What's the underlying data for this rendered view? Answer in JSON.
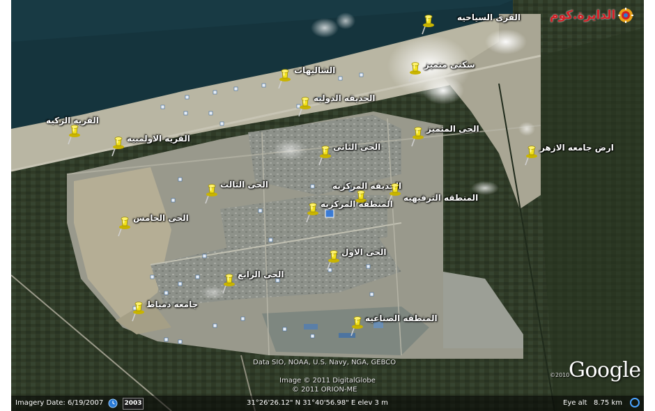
{
  "site_logo": {
    "text": "الدايرة.كوم"
  },
  "placemarks": [
    {
      "id": "tourist-villages",
      "label": "القرى السياحيه"
    },
    {
      "id": "chalets",
      "label": "الشاليهات"
    },
    {
      "id": "distinguished-housing",
      "label": "سكنى متميز"
    },
    {
      "id": "international-park",
      "label": "الحديقه الدوليه"
    },
    {
      "id": "zaki-village",
      "label": "القريه الزكيه"
    },
    {
      "id": "olympic-village",
      "label": "القريه الاولمبيه"
    },
    {
      "id": "distinguished-district",
      "label": "الحى المتميز"
    },
    {
      "id": "second-district",
      "label": "الحى الثانى"
    },
    {
      "id": "azhar-university-land",
      "label": "ارض جامعه الازهر"
    },
    {
      "id": "third-district",
      "label": "الحى الثالث"
    },
    {
      "id": "central-park",
      "label": "الحديقه المركزيه"
    },
    {
      "id": "central-area",
      "label": "المنطقه المركزيه"
    },
    {
      "id": "recreation-area",
      "label": "المنطقه الترفيهيه"
    },
    {
      "id": "fifth-district",
      "label": "الحى الخامس"
    },
    {
      "id": "first-district",
      "label": "الحى الاول"
    },
    {
      "id": "fourth-district",
      "label": "الحى الرابع"
    },
    {
      "id": "damietta-university",
      "label": "جامعه دمياط"
    },
    {
      "id": "industrial-area",
      "label": "المنطقه الصناعيه"
    }
  ],
  "credits": {
    "data_sources": "Data SIO, NOAA, U.S. Navy, NGA, GEBCO",
    "image_credit": "Image © 2011 DigitalGlobe",
    "orion_credit": "© 2011 ORION-ME",
    "google_logo": "Google",
    "google_year": "©2010"
  },
  "status_bar": {
    "imagery_date": "Imagery Date: 6/19/2007",
    "year_button": "2003",
    "coordinates": "31°26'26.12\" N  31°40'56.98\" E  elev   3 m",
    "eye_alt_label": "Eye alt",
    "eye_alt_value": "8.75 km"
  },
  "colors": {
    "sea": "#15343d",
    "farmland": "#2f3a26",
    "beach": "#b9b6a3",
    "urban": "#8f9288",
    "pin": "#f3e21b",
    "site_logo": "#d31f26"
  },
  "icons": {
    "history": "clock-history-icon",
    "compass": "compass-ring-icon",
    "pin": "yellow-pushpin-icon",
    "site_logo": "sun-mosaic-logo-icon"
  }
}
